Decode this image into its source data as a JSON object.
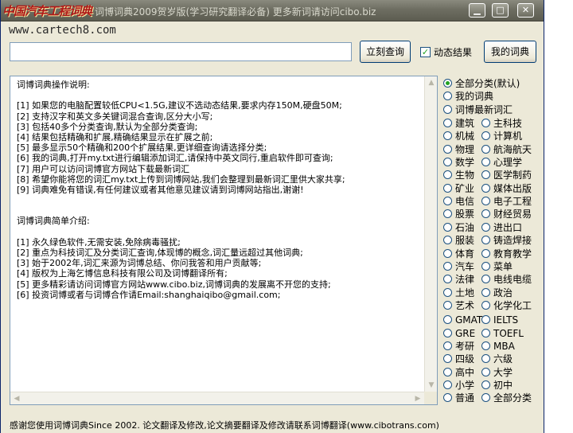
{
  "window": {
    "logo_text": "中国汽车工程词典",
    "title": "词博词典2009贺岁版(学习研究翻译必备) 更多新词请访问cibo.biz",
    "controls": {
      "minimize": "▁",
      "maximize": "□",
      "close": "✕"
    }
  },
  "url_label": "www.cartech8.com",
  "search": {
    "value": "",
    "placeholder": ""
  },
  "toolbar": {
    "query_button": "立刻查询",
    "dynamic_label": "动态结果",
    "dynamic_checked": true,
    "my_dict_button": "我的词典"
  },
  "content": {
    "lines": [
      "词博词典操作说明:",
      "",
      "[1] 如果您的电脑配置较低CPU<1.5G,建议不选动态结果,要求内存150M,硬盘50M;",
      "[2] 支持汉字和英文多关键词混合查询,区分大小写;",
      "[3] 包括40多个分类查询,默认为全部分类查询;",
      "[4] 结果包括精确和扩展,精确结果显示在扩展之前;",
      "[5] 最多显示50个精确和200个扩展结果,更详细查询请选择分类;",
      "[6] 我的词典,打开my.txt进行编辑添加词汇,请保持中英文同行,重启软件即可查询;",
      "[7] 用户可以访问词博官方网站下载最新词汇",
      "[8] 希望你能将您的词汇my.txt上传到词博网站,我们会整理到最新词汇里供大家共享;",
      "[9] 词典难免有错误,有任何建议或者其他意见建议请到词博网站指出,谢谢!",
      "",
      "",
      "词博词典简单介绍:",
      "",
      "[1] 永久绿色软件,无需安装,免除病毒骚扰;",
      "[2] 重点为科技词汇及分类词汇查询,体现博的概念,词汇量远超过其他词典;",
      "[3] 始于2002年,词汇来源为词博总结、你问我答和用户贡献等;",
      "[4] 版权为上海乞博信息科技有限公司及词博翻译所有;",
      "[5] 更多精彩请访问词博官方网站www.cibo.biz,词博词典的发展离不开您的支持;",
      "[6] 投资词博或者与词博合作请Email:shanghaiqibo@gmail.com;"
    ]
  },
  "categories": {
    "selected": "全部分类(默认)",
    "top": [
      "全部分类(默认)",
      "我的词典",
      "词博最新词汇"
    ],
    "left": [
      "建筑",
      "机械",
      "物理",
      "数学",
      "生物",
      "矿业",
      "电信",
      "股票",
      "石油",
      "服装",
      "体育",
      "汽车",
      "法律",
      "土地",
      "艺术",
      "GMAT",
      "GRE",
      "考研",
      "四级",
      "高中",
      "小学",
      "普通"
    ],
    "right": [
      "主科技",
      "计算机",
      "航海航天",
      "心理学",
      "医学制药",
      "媒体出版",
      "电子工程",
      "财经贸易",
      "进出口",
      "铸造焊接",
      "教育教学",
      "菜单",
      "电线电缆",
      "政治",
      "化学化工",
      "IELTS",
      "TOEFL",
      "MBA",
      "六级",
      "大学",
      "初中",
      "全部分类"
    ]
  },
  "status": "感谢您使用词博词典Since 2002. 论文翻译及修改,论文摘要翻译及修改请联系词博翻译(www.cibotrans.com)"
}
